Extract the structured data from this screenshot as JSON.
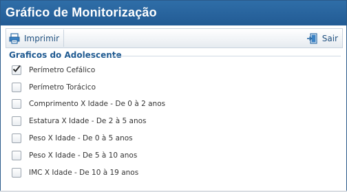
{
  "window": {
    "title": "Gráfico de Monitorização"
  },
  "toolbar": {
    "print_label": "Imprimir",
    "exit_label": "Sair"
  },
  "section": {
    "title": "Graficos do Adolescente",
    "items": [
      {
        "label": "Perímetro Cefálico",
        "checked": true
      },
      {
        "label": "Perímetro Torácico",
        "checked": false
      },
      {
        "label": "Comprimento X Idade - De 0 à 2 anos",
        "checked": false
      },
      {
        "label": "Estatura X Idade - De 2 à 5 anos",
        "checked": false
      },
      {
        "label": "Peso X Idade - De 0 à 5 anos",
        "checked": false
      },
      {
        "label": "Peso X Idade - De 5 à 10 anos",
        "checked": false
      },
      {
        "label": "IMC X Idade - De 10 à 19 anos",
        "checked": false
      }
    ]
  }
}
